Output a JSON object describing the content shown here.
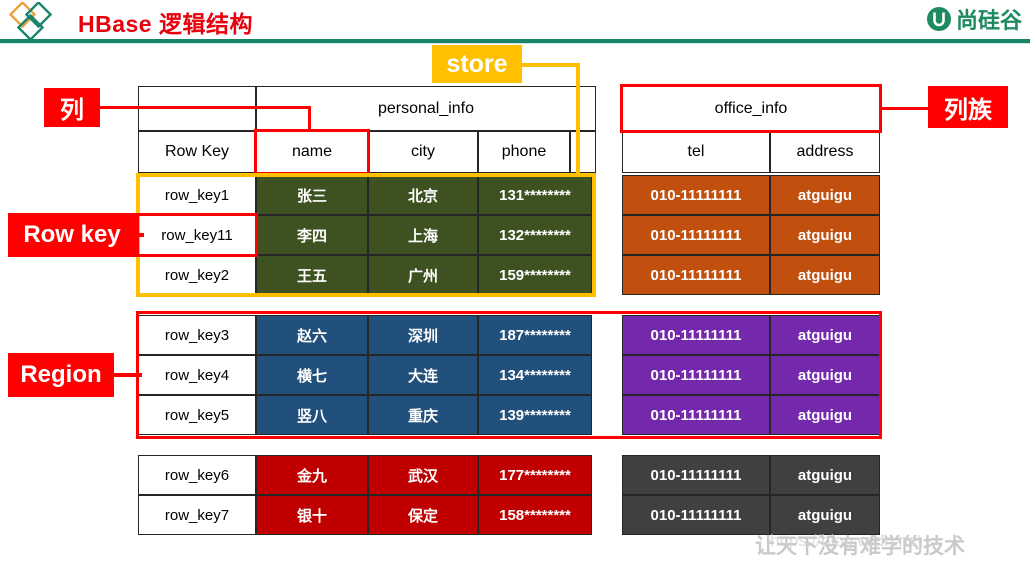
{
  "header": {
    "title": "HBase 逻辑结构",
    "brand": "尚硅谷",
    "logo_icon": "diamond-logo-icon",
    "brand_icon": "u-circle-icon"
  },
  "annotations": {
    "column": "列",
    "column_family": "列族",
    "row_key": "Row key",
    "region": "Region",
    "store": "store"
  },
  "table": {
    "family_headers": [
      {
        "label": "personal_info"
      },
      {
        "label": "office_info"
      }
    ],
    "columns": [
      {
        "label": "Row Key"
      },
      {
        "label": "name"
      },
      {
        "label": "city"
      },
      {
        "label": "phone"
      },
      {
        "label": "tel"
      },
      {
        "label": "address"
      }
    ],
    "groups": [
      {
        "name": "region-1",
        "personal_color": "#3d5220",
        "office_color": "#c1500f",
        "rows": [
          {
            "row_key": "row_key1",
            "name": "张三",
            "city": "北京",
            "phone": "131********",
            "tel": "010-11111111",
            "address": "atguigu"
          },
          {
            "row_key": "row_key11",
            "name": "李四",
            "city": "上海",
            "phone": "132********",
            "tel": "010-11111111",
            "address": "atguigu"
          },
          {
            "row_key": "row_key2",
            "name": "王五",
            "city": "广州",
            "phone": "159********",
            "tel": "010-11111111",
            "address": "atguigu"
          }
        ]
      },
      {
        "name": "region-2",
        "personal_color": "#21507c",
        "office_color": "#7429ac",
        "rows": [
          {
            "row_key": "row_key3",
            "name": "赵六",
            "city": "深圳",
            "phone": "187********",
            "tel": "010-11111111",
            "address": "atguigu"
          },
          {
            "row_key": "row_key4",
            "name": "横七",
            "city": "大连",
            "phone": "134********",
            "tel": "010-11111111",
            "address": "atguigu"
          },
          {
            "row_key": "row_key5",
            "name": "竖八",
            "city": "重庆",
            "phone": "139********",
            "tel": "010-11111111",
            "address": "atguigu"
          }
        ]
      },
      {
        "name": "region-3",
        "personal_color": "#c00000",
        "office_color": "#404040",
        "rows": [
          {
            "row_key": "row_key6",
            "name": "金九",
            "city": "武汉",
            "phone": "177********",
            "tel": "010-11111111",
            "address": "atguigu"
          },
          {
            "row_key": "row_key7",
            "name": "银十",
            "city": "保定",
            "phone": "158********",
            "tel": "010-11111111",
            "address": "atguigu"
          }
        ]
      }
    ]
  },
  "watermark": {
    "text": "让天下没有难学的技术",
    "overlay": "https://blog.csdn.net"
  },
  "colors": {
    "accent_red": "#ff0000",
    "store_yellow": "#ffc000",
    "brand_green": "#19846b",
    "title_red": "#e8000d"
  }
}
